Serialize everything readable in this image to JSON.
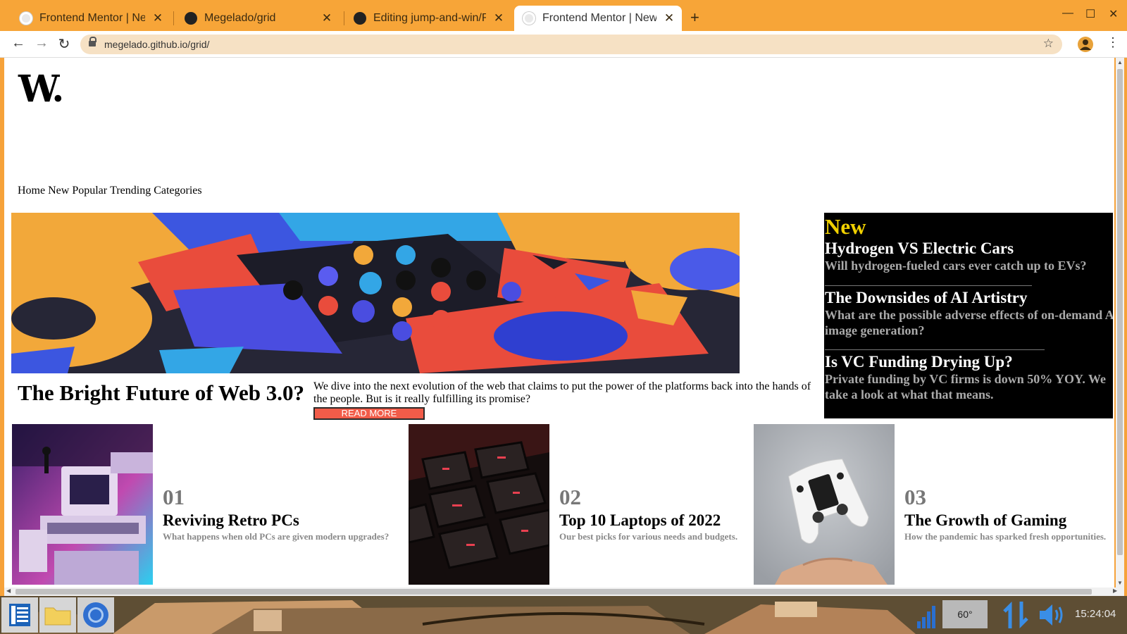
{
  "browser": {
    "tabs": [
      {
        "title": "Frontend Mentor | News h",
        "favicon": "frontend-mentor-icon",
        "active": false
      },
      {
        "title": "Megelado/grid",
        "favicon": "github-icon",
        "active": false
      },
      {
        "title": "Editing jump-and-win/RE",
        "favicon": "github-icon",
        "active": false
      },
      {
        "title": "Frontend Mentor | News h",
        "favicon": "frontend-mentor-icon",
        "active": true
      }
    ],
    "new_tab_glyph": "+",
    "close_glyph": "✕",
    "url": "megelado.github.io/grid/",
    "window_controls": {
      "minimize": "—",
      "maximize": "☐",
      "close": "✕"
    },
    "accent_color": "#f7a538"
  },
  "page": {
    "logo": "W.",
    "nav": [
      "Home",
      "New",
      "Popular",
      "Trending",
      "Categories"
    ],
    "hero": {
      "title": "The Bright Future of Web 3.0?",
      "description": "We dive into the next evolution of the web that claims to put the power of the platforms back into the hands of the people. But is it really fulfilling its promise?",
      "button": "READ MORE",
      "button_color": "#f25c49"
    },
    "new_section": {
      "heading": "New",
      "heading_color": "#f0d000",
      "items": [
        {
          "title": "Hydrogen VS Electric Cars",
          "desc": "Will hydrogen-fueled cars ever catch up to EVs?"
        },
        {
          "title": "The Downsides of AI Artistry",
          "desc": "What are the possible adverse effects of on-demand AI image generation?"
        },
        {
          "title": "Is VC Funding Drying Up?",
          "desc": "Private funding by VC firms is down 50% YOY. We take a look at what that means."
        }
      ]
    },
    "cards": [
      {
        "num": "01",
        "title": "Reviving Retro PCs",
        "desc": "What happens when old PCs are given modern upgrades?"
      },
      {
        "num": "02",
        "title": "Top 10 Laptops of 2022",
        "desc": "Our best picks for various needs and budgets."
      },
      {
        "num": "03",
        "title": "The Growth of Gaming",
        "desc": "How the pandemic has sparked fresh opportunities."
      }
    ]
  },
  "taskbar": {
    "weather": "60°",
    "clock": "15:24:04"
  }
}
